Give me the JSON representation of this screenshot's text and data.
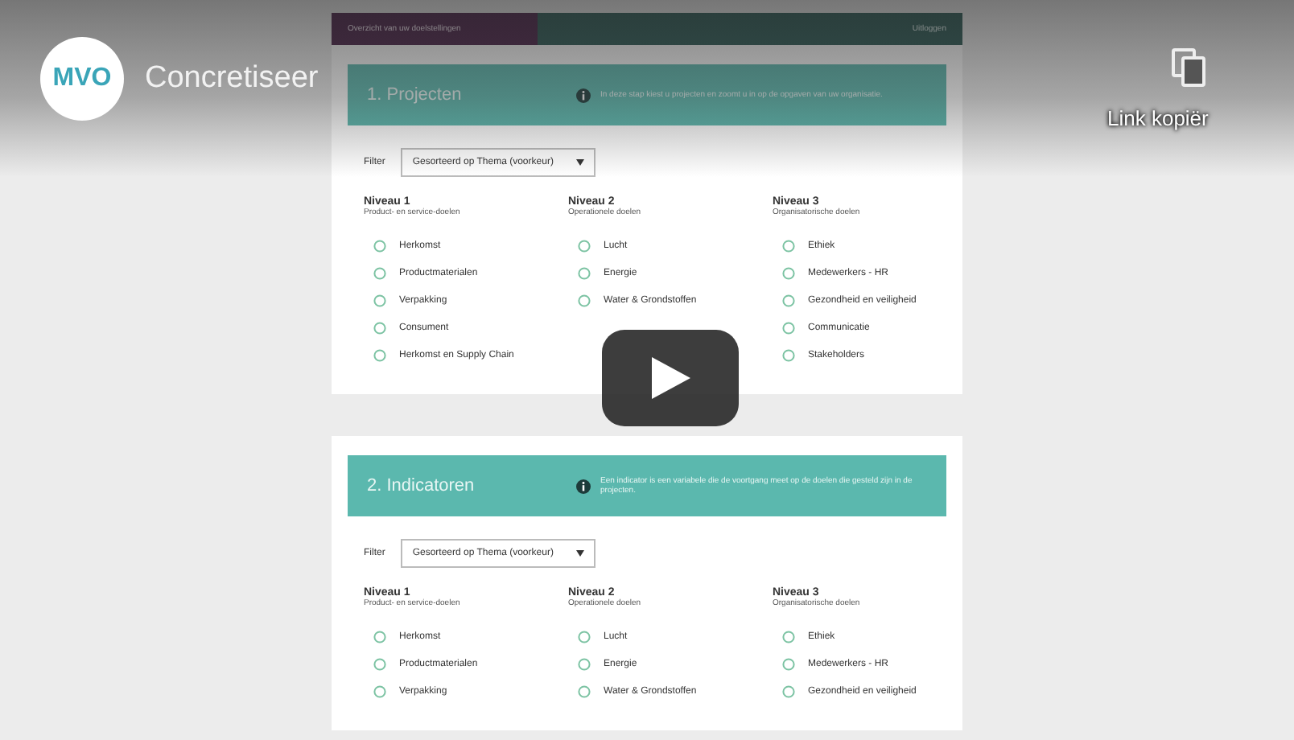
{
  "player": {
    "logo": "MVO",
    "title": "Concretiseer",
    "copy_link": "Link kopiër"
  },
  "top_bar": {
    "left": "Overzicht van uw doelstellingen",
    "right": "Uitloggen"
  },
  "sections": [
    {
      "title": "1. Projecten",
      "info": "In deze stap kiest u projecten en zoomt u in op de opgaven van uw organisatie.",
      "filter_label": "Filter",
      "filter_value": "Gesorteerd op Thema (voorkeur)",
      "columns": [
        {
          "title": "Niveau 1",
          "subtitle": "Product- en service-doelen",
          "items": [
            "Herkomst",
            "Productmaterialen",
            "Verpakking",
            "Consument",
            "Herkomst en Supply Chain"
          ]
        },
        {
          "title": "Niveau 2",
          "subtitle": "Operationele doelen",
          "items": [
            "Lucht",
            "Energie",
            "Water & Grondstoffen"
          ]
        },
        {
          "title": "Niveau 3",
          "subtitle": "Organisatorische doelen",
          "items": [
            "Ethiek",
            "Medewerkers - HR",
            "Gezondheid en veiligheid",
            "Communicatie",
            "Stakeholders"
          ]
        }
      ]
    },
    {
      "title": "2. Indicatoren",
      "info": "Een indicator is een variabele die de voortgang meet op de doelen die gesteld zijn in de projecten.",
      "filter_label": "Filter",
      "filter_value": "Gesorteerd op Thema (voorkeur)",
      "columns": [
        {
          "title": "Niveau 1",
          "subtitle": "Product- en service-doelen",
          "items": [
            "Herkomst",
            "Productmaterialen",
            "Verpakking"
          ]
        },
        {
          "title": "Niveau 2",
          "subtitle": "Operationele doelen",
          "items": [
            "Lucht",
            "Energie",
            "Water & Grondstoffen"
          ]
        },
        {
          "title": "Niveau 3",
          "subtitle": "Organisatorische doelen",
          "items": [
            "Ethiek",
            "Medewerkers - HR",
            "Gezondheid en veiligheid"
          ]
        }
      ]
    }
  ]
}
